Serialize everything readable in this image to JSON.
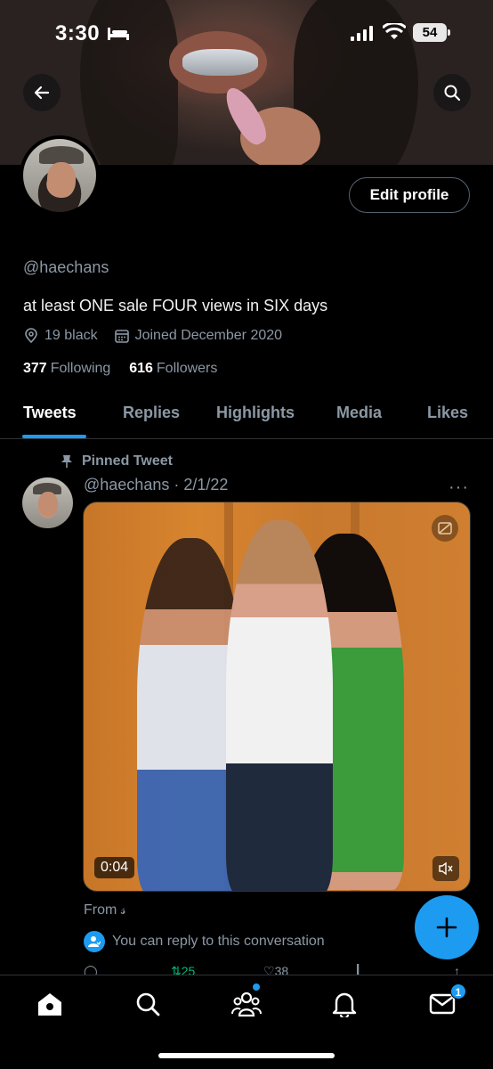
{
  "status_bar": {
    "time": "3:30",
    "battery": "54"
  },
  "profile": {
    "handle": "@haechans",
    "bio": "at least ONE sale FOUR views in SIX days",
    "location": "19 black",
    "joined": "Joined December 2020",
    "following_count": "377",
    "following_label": "Following",
    "followers_count": "616",
    "followers_label": "Followers",
    "edit_label": "Edit profile"
  },
  "tabs": [
    "Tweets",
    "Replies",
    "Highlights",
    "Media",
    "Likes"
  ],
  "active_tab": "Tweets",
  "tweet": {
    "pinned_label": "Pinned Tweet",
    "header": "@haechans · 2/1/22",
    "more": "···",
    "video_duration": "0:04",
    "from": "From 𝓈",
    "reply_note": "You can reply to this conversation",
    "retweets": "25",
    "likes": "38"
  },
  "bottom_nav": {
    "items": [
      "home-icon",
      "search-icon",
      "communities-icon",
      "notifications-icon",
      "messages-icon"
    ],
    "messages_badge": "1"
  },
  "colors": {
    "accent": "#1d9bf0",
    "background": "#000000",
    "muted": "#8b98a5"
  }
}
